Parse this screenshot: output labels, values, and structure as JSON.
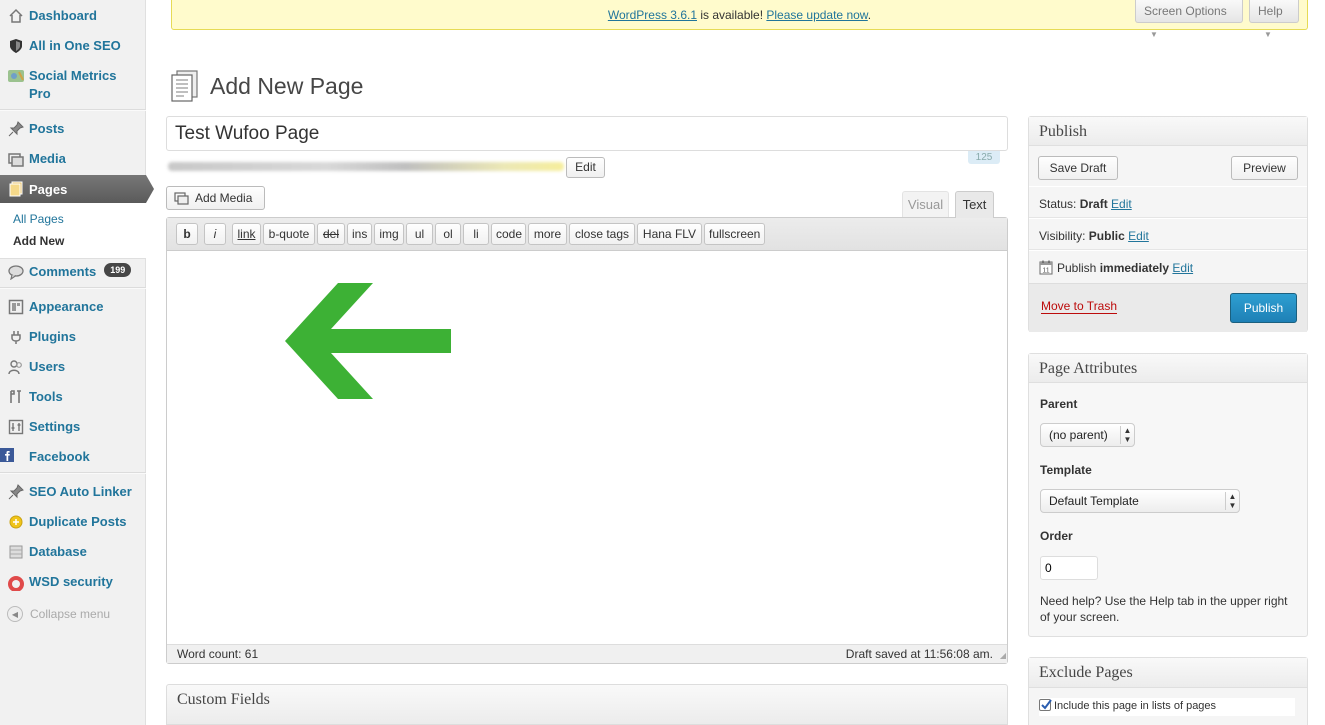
{
  "sidebar": {
    "items": [
      {
        "key": "dashboard",
        "label": "Dashboard"
      },
      {
        "key": "all-in-one-seo",
        "label": "All in One SEO"
      },
      {
        "key": "social-metrics",
        "label": "Social Metrics Pro"
      },
      {
        "key": "posts",
        "label": "Posts"
      },
      {
        "key": "media",
        "label": "Media"
      },
      {
        "key": "pages",
        "label": "Pages"
      },
      {
        "key": "comments",
        "label": "Comments"
      },
      {
        "key": "appearance",
        "label": "Appearance"
      },
      {
        "key": "plugins",
        "label": "Plugins"
      },
      {
        "key": "users",
        "label": "Users"
      },
      {
        "key": "tools",
        "label": "Tools"
      },
      {
        "key": "settings",
        "label": "Settings"
      },
      {
        "key": "facebook",
        "label": "Facebook"
      },
      {
        "key": "seo-auto-linker",
        "label": "SEO Auto Linker"
      },
      {
        "key": "duplicate-posts",
        "label": "Duplicate Posts"
      },
      {
        "key": "database",
        "label": "Database"
      },
      {
        "key": "wsd-security",
        "label": "WSD security"
      }
    ],
    "pages_submenu": [
      "All Pages",
      "Add New"
    ],
    "comments_badge": "199",
    "collapse_label": "Collapse menu"
  },
  "notice": {
    "version_link": "WordPress 3.6.1",
    "middle_text": " is available! ",
    "update_link": "Please update now",
    "end_text": "."
  },
  "top_buttons": {
    "screen_options": "Screen Options",
    "help": "Help"
  },
  "page": {
    "title": "Add New Page",
    "post_title_value": "Test Wufoo Page",
    "permalink_edit": "Edit",
    "char_count": "125"
  },
  "editor": {
    "add_media": "Add Media",
    "tab_visual": "Visual",
    "tab_text": "Text",
    "quicktags": [
      "b",
      "i",
      "link",
      "b-quote",
      "del",
      "ins",
      "img",
      "ul",
      "ol",
      "li",
      "code",
      "more",
      "close tags",
      "Hana FLV",
      "fullscreen"
    ],
    "word_count": "Word count: 61",
    "draft_saved": "Draft saved at 11:56:08 am.",
    "arrow_color": "#3db135"
  },
  "custom_fields": {
    "title": "Custom Fields"
  },
  "publish": {
    "title": "Publish",
    "save_draft": "Save Draft",
    "preview": "Preview",
    "status_label": "Status: ",
    "status_value": "Draft",
    "visibility_label": "Visibility: ",
    "visibility_value": "Public",
    "publish_label": "Publish ",
    "publish_value": "immediately",
    "edit": "Edit",
    "move_to_trash": "Move to Trash",
    "publish_button": "Publish"
  },
  "page_attributes": {
    "title": "Page Attributes",
    "parent_label": "Parent",
    "parent_value": "(no parent)",
    "template_label": "Template",
    "template_value": "Default Template",
    "order_label": "Order",
    "order_value": "0",
    "help_text": "Need help? Use the Help tab in the upper right of your screen."
  },
  "exclude_pages": {
    "title": "Exclude Pages",
    "checkbox_label": "Include this page in lists of pages"
  },
  "colors": {
    "link": "#21759b",
    "publish_button": "#2a8bbf",
    "trash": "#bc0b0b"
  }
}
